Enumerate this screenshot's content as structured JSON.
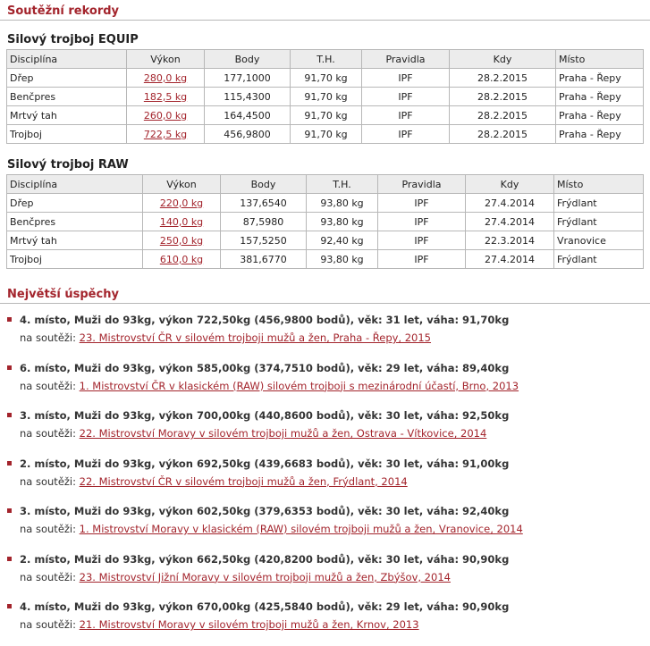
{
  "section1_title": "Soutěžní rekordy",
  "equip": {
    "title": "Silový trojboj EQUIP",
    "headers": [
      "Disciplína",
      "Výkon",
      "Body",
      "T.H.",
      "Pravidla",
      "Kdy",
      "Místo"
    ],
    "rows": [
      [
        "Dřep",
        "280,0 kg",
        "177,1000",
        "91,70 kg",
        "IPF",
        "28.2.2015",
        "Praha - Řepy"
      ],
      [
        "Benčpres",
        "182,5 kg",
        "115,4300",
        "91,70 kg",
        "IPF",
        "28.2.2015",
        "Praha - Řepy"
      ],
      [
        "Mrtvý tah",
        "260,0 kg",
        "164,4500",
        "91,70 kg",
        "IPF",
        "28.2.2015",
        "Praha - Řepy"
      ],
      [
        "Trojboj",
        "722,5 kg",
        "456,9800",
        "91,70 kg",
        "IPF",
        "28.2.2015",
        "Praha - Řepy"
      ]
    ]
  },
  "raw": {
    "title": "Silový trojboj RAW",
    "headers": [
      "Disciplína",
      "Výkon",
      "Body",
      "T.H.",
      "Pravidla",
      "Kdy",
      "Místo"
    ],
    "rows": [
      [
        "Dřep",
        "220,0 kg",
        "137,6540",
        "93,80 kg",
        "IPF",
        "27.4.2014",
        "Frýdlant"
      ],
      [
        "Benčpres",
        "140,0 kg",
        "87,5980",
        "93,80 kg",
        "IPF",
        "27.4.2014",
        "Frýdlant"
      ],
      [
        "Mrtvý tah",
        "250,0 kg",
        "157,5250",
        "92,40 kg",
        "IPF",
        "22.3.2014",
        "Vranovice"
      ],
      [
        "Trojboj",
        "610,0 kg",
        "381,6770",
        "93,80 kg",
        "IPF",
        "27.4.2014",
        "Frýdlant"
      ]
    ]
  },
  "section2_title": "Největší úspěchy",
  "competition_prefix": "na soutěži:",
  "achievements": [
    {
      "summary": "4. místo, Muži do 93kg, výkon 722,50kg (456,9800 bodů), věk: 31 let, váha: 91,70kg",
      "competition": "23. Mistrovství ČR v silovém trojboji mužů a žen, Praha - Řepy, 2015"
    },
    {
      "summary": "6. místo, Muži do 93kg, výkon 585,00kg (374,7510 bodů), věk: 29 let, váha: 89,40kg",
      "competition": "1. Mistrovství ČR v klasickém (RAW) silovém trojboji s mezinárodní účastí, Brno, 2013"
    },
    {
      "summary": "3. místo, Muži do 93kg, výkon 700,00kg (440,8600 bodů), věk: 30 let, váha: 92,50kg",
      "competition": "22. Mistrovství Moravy v silovém trojboji mužů a žen, Ostrava - Vítkovice, 2014"
    },
    {
      "summary": "2. místo, Muži do 93kg, výkon 692,50kg (439,6683 bodů), věk: 30 let, váha: 91,00kg",
      "competition": "22. Mistrovství ČR v silovém trojboji mužů a žen, Frýdlant, 2014"
    },
    {
      "summary": "3. místo, Muži do 93kg, výkon 602,50kg (379,6353 bodů), věk: 30 let, váha: 92,40kg",
      "competition": "1. Mistrovství Moravy v klasickém (RAW) silovém trojboji mužů a žen, Vranovice, 2014"
    },
    {
      "summary": "2. místo, Muži do 93kg, výkon 662,50kg (420,8200 bodů), věk: 30 let, váha: 90,90kg",
      "competition": "23. Mistrovství Jižní Moravy v silovém trojboji mužů a žen, Zbýšov, 2014"
    },
    {
      "summary": "4. místo, Muži do 93kg, výkon 670,00kg (425,5840 bodů), věk: 29 let, váha: 90,90kg",
      "competition": "21. Mistrovství Moravy v silovém trojboji mužů a žen, Krnov, 2013"
    }
  ]
}
